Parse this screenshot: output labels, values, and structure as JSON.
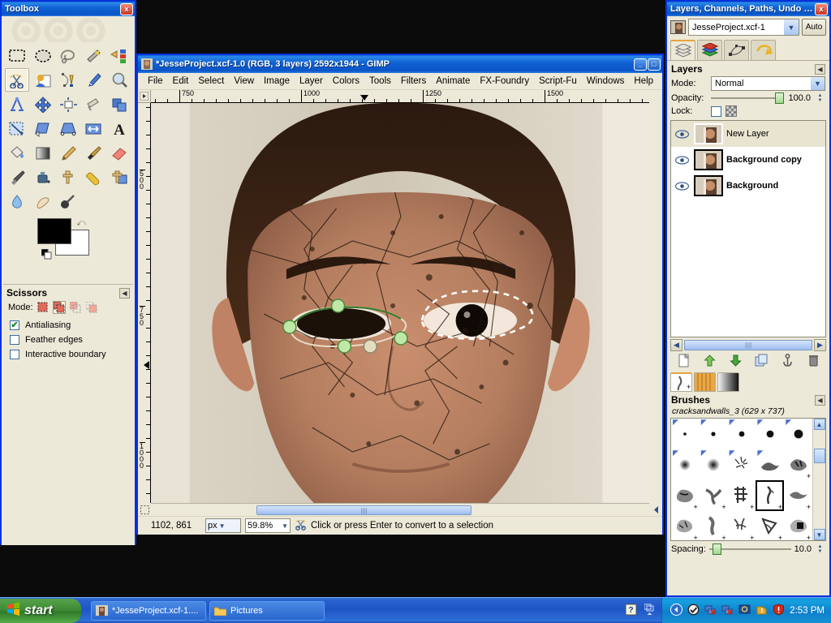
{
  "toolbox": {
    "title": "Toolbox",
    "close_label": "x",
    "tools": [
      {
        "name": "rect-select-tool",
        "label": "Rectangle Select"
      },
      {
        "name": "ellipse-select-tool",
        "label": "Ellipse Select"
      },
      {
        "name": "free-select-tool",
        "label": "Free Select"
      },
      {
        "name": "fuzzy-select-tool",
        "label": "Fuzzy Select"
      },
      {
        "name": "select-by-color-tool",
        "label": "Select by Color"
      },
      {
        "name": "scissors-select-tool",
        "label": "Scissors Select"
      },
      {
        "name": "foreground-select-tool",
        "label": "Foreground Select"
      },
      {
        "name": "paths-tool",
        "label": "Paths"
      },
      {
        "name": "color-picker-tool",
        "label": "Color Picker"
      },
      {
        "name": "zoom-tool",
        "label": "Zoom"
      },
      {
        "name": "measure-tool",
        "label": "Measure"
      },
      {
        "name": "move-tool",
        "label": "Move"
      },
      {
        "name": "alignment-tool",
        "label": "Alignment"
      },
      {
        "name": "crop-tool",
        "label": "Crop"
      },
      {
        "name": "rotate-tool",
        "label": "Rotate"
      },
      {
        "name": "scale-tool",
        "label": "Scale"
      },
      {
        "name": "shear-tool",
        "label": "Shear"
      },
      {
        "name": "perspective-tool",
        "label": "Perspective"
      },
      {
        "name": "flip-tool",
        "label": "Flip"
      },
      {
        "name": "text-tool",
        "label": "Text"
      },
      {
        "name": "bucket-fill-tool",
        "label": "Bucket Fill"
      },
      {
        "name": "gradient-tool",
        "label": "Blend"
      },
      {
        "name": "pencil-tool",
        "label": "Pencil"
      },
      {
        "name": "paintbrush-tool",
        "label": "Paintbrush"
      },
      {
        "name": "eraser-tool",
        "label": "Eraser"
      },
      {
        "name": "airbrush-tool",
        "label": "Airbrush"
      },
      {
        "name": "ink-tool",
        "label": "Ink"
      },
      {
        "name": "clone-tool",
        "label": "Clone"
      },
      {
        "name": "heal-tool",
        "label": "Heal"
      },
      {
        "name": "perspective-clone-tool",
        "label": "Perspective Clone"
      },
      {
        "name": "blur-sharpen-tool",
        "label": "Blur / Sharpen"
      },
      {
        "name": "smudge-tool",
        "label": "Smudge"
      },
      {
        "name": "dodge-burn-tool",
        "label": "Dodge / Burn"
      }
    ],
    "active_tool_index": 5,
    "colors": {
      "foreground": "#000000",
      "background": "#ffffff"
    }
  },
  "tool_options": {
    "title": "Scissors",
    "mode_label": "Mode:",
    "modes": [
      "replace",
      "add",
      "subtract",
      "intersect"
    ],
    "selected_mode_index": 1,
    "checkboxes": [
      {
        "label": "Antialiasing",
        "checked": true
      },
      {
        "label": "Feather edges",
        "checked": false
      },
      {
        "label": "Interactive boundary",
        "checked": false
      }
    ]
  },
  "image_window": {
    "title": "*JesseProject.xcf-1.0 (RGB, 3 layers) 2592x1944 - GIMP",
    "menu": [
      "File",
      "Edit",
      "Select",
      "View",
      "Image",
      "Layer",
      "Colors",
      "Tools",
      "Filters",
      "Animate",
      "FX-Foundry",
      "Script-Fu",
      "Windows",
      "Help"
    ],
    "minimize_label": "_",
    "maximize_label": "□",
    "rulers": {
      "horizontal_labels": [
        "750",
        "1000",
        "1250",
        "1500"
      ],
      "vertical_labels": [
        "500",
        "750",
        "1000"
      ],
      "unit": "px"
    },
    "status": {
      "position": "1102, 861",
      "unit": "px",
      "zoom": "59.8%",
      "message": "Click or press Enter to convert to a selection"
    }
  },
  "dock": {
    "title": "Layers, Channels, Paths, Undo -...",
    "close_label": "x",
    "image_name": "JesseProject.xcf-1",
    "auto_label": "Auto",
    "tabs": [
      {
        "name": "layers-tab",
        "label": "Layers"
      },
      {
        "name": "channels-tab",
        "label": "Channels"
      },
      {
        "name": "paths-tab",
        "label": "Paths"
      },
      {
        "name": "undo-history-tab",
        "label": "Undo History"
      }
    ],
    "selected_tab_index": 0,
    "layers_panel": {
      "title": "Layers",
      "mode_label": "Mode:",
      "mode_value": "Normal",
      "opacity_label": "Opacity:",
      "opacity_value": "100.0",
      "lock_label": "Lock:",
      "layers": [
        {
          "name": "New Layer",
          "visible": true,
          "selected": true,
          "bold": false
        },
        {
          "name": "Background copy",
          "visible": true,
          "selected": false,
          "bold": true
        },
        {
          "name": "Background",
          "visible": true,
          "selected": false,
          "bold": true
        }
      ],
      "buttons": [
        {
          "name": "new-layer-button",
          "label": "New Layer"
        },
        {
          "name": "raise-layer-button",
          "label": "Raise Layer"
        },
        {
          "name": "lower-layer-button",
          "label": "Lower Layer"
        },
        {
          "name": "duplicate-layer-button",
          "label": "Duplicate Layer"
        },
        {
          "name": "anchor-layer-button",
          "label": "Anchor Layer"
        },
        {
          "name": "delete-layer-button",
          "label": "Delete Layer"
        }
      ]
    },
    "brushes_panel": {
      "title": "Brushes",
      "selected_brush": "cracksandwalls_3 (629 x 737)",
      "spacing_label": "Spacing:",
      "spacing_value": "10.0",
      "tabs": [
        {
          "name": "brushes-tab",
          "label": "Brushes"
        },
        {
          "name": "patterns-tab",
          "label": "Patterns"
        },
        {
          "name": "gradients-tab",
          "label": "Gradients"
        }
      ],
      "selected_tab_index": 0,
      "selected_cell_index": 18
    }
  },
  "taskbar": {
    "start_label": "start",
    "tasks": [
      {
        "name": "taskbar-item-gimp",
        "label": "*JesseProject.xcf-1...."
      },
      {
        "name": "taskbar-item-pictures",
        "label": "Pictures"
      }
    ],
    "clock": "2:53 PM"
  }
}
